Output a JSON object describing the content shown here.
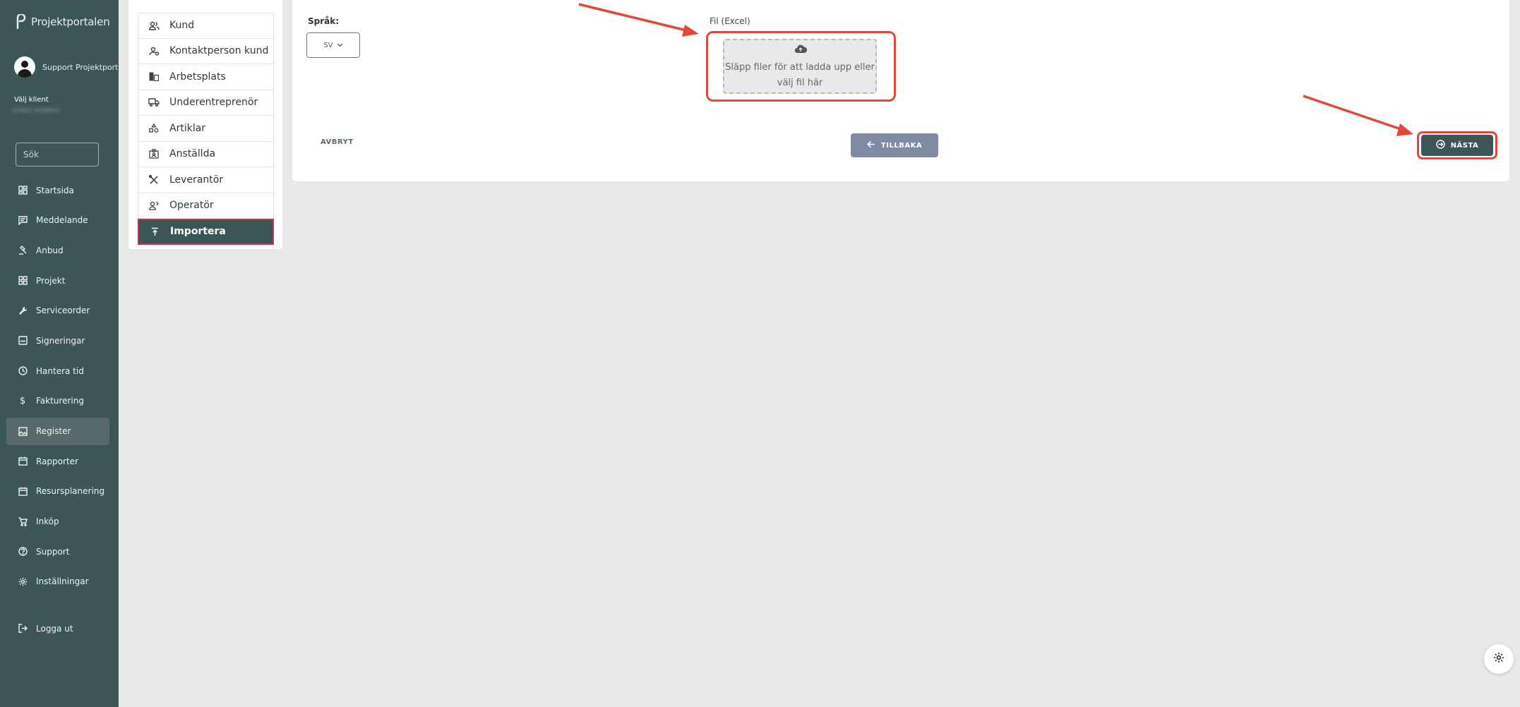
{
  "app": {
    "title": "Projektportalen"
  },
  "user": {
    "name": "Support Projektportalen"
  },
  "client": {
    "label": "Välj klient",
    "value": "[client hidden]"
  },
  "search": {
    "placeholder": "Sök"
  },
  "sidebar": {
    "items": [
      {
        "label": "Startsida",
        "icon": "dashboard-icon"
      },
      {
        "label": "Meddelande",
        "icon": "message-icon"
      },
      {
        "label": "Anbud",
        "icon": "gavel-icon"
      },
      {
        "label": "Projekt",
        "icon": "grid-icon"
      },
      {
        "label": "Serviceorder",
        "icon": "wrench-icon"
      },
      {
        "label": "Signeringar",
        "icon": "signature-icon"
      },
      {
        "label": "Hantera tid",
        "icon": "clock-icon"
      },
      {
        "label": "Fakturering",
        "icon": "dollar-icon"
      },
      {
        "label": "Register",
        "icon": "image-icon",
        "active": true
      },
      {
        "label": "Rapporter",
        "icon": "calendar-icon"
      },
      {
        "label": "Resursplanering",
        "icon": "calendar-icon"
      },
      {
        "label": "Inköp",
        "icon": "cart-icon"
      },
      {
        "label": "Support",
        "icon": "help-icon"
      },
      {
        "label": "Inställningar",
        "icon": "gear-icon"
      }
    ],
    "logout": {
      "label": "Logga ut",
      "icon": "logout-icon"
    }
  },
  "register_menu": {
    "items": [
      {
        "label": "Kund",
        "icon": "people-icon"
      },
      {
        "label": "Kontaktperson kund",
        "icon": "contact-person-icon"
      },
      {
        "label": "Arbetsplats",
        "icon": "building-icon"
      },
      {
        "label": "Underentreprenör",
        "icon": "truck-icon"
      },
      {
        "label": "Artiklar",
        "icon": "shapes-icon"
      },
      {
        "label": "Anställda",
        "icon": "badge-icon"
      },
      {
        "label": "Leverantör",
        "icon": "tools-icon"
      },
      {
        "label": "Operatör",
        "icon": "operator-icon"
      },
      {
        "label": "Importera",
        "icon": "upload-icon",
        "active": true
      }
    ]
  },
  "import_form": {
    "language_label": "Språk:",
    "language_value": "SV",
    "file_label": "Fil (Excel)",
    "dropzone_text": "Släpp filer för att ladda upp eller välj fil här",
    "cancel_label": "AVBRYT",
    "back_label": "TILLBAKA",
    "next_label": "NÄSTA"
  },
  "colors": {
    "sidebar_bg": "#3c5658",
    "highlight": "#e2473b",
    "back_button": "#7f8aa3",
    "active_item_border": "#c0394b"
  }
}
